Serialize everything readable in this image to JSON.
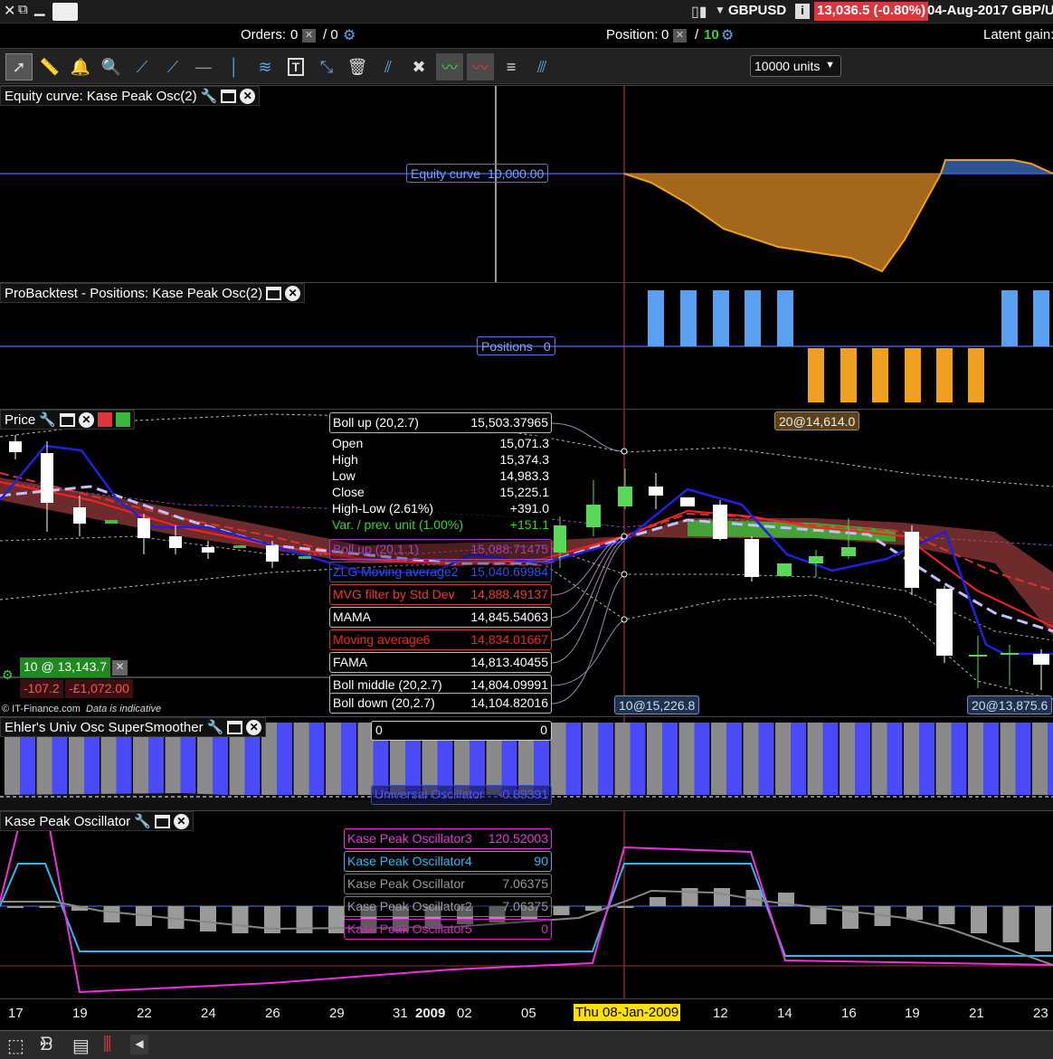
{
  "titlebar": {
    "symbol": "GBPUSD",
    "price_change": "13,036.5 (-0.80%)",
    "date_title": "04-Aug-2017 GBP/U"
  },
  "orders_bar": {
    "orders_label": "Orders:",
    "orders_count": "0",
    "orders_sep": "/ 0",
    "position_label": "Position:",
    "position_count": "0",
    "position_sep": "/",
    "position_units": "10",
    "latent_gain": "Latent gain:"
  },
  "toolbar": {
    "units_select": "10000 units",
    "tools": [
      "pointer-icon",
      "ruler-icon",
      "alert-bell-icon",
      "zoom-icon",
      "line-icon",
      "ray-icon",
      "horizontal-line-icon",
      "vertical-line-icon",
      "fibonacci-icon",
      "text-icon",
      "resize-icon",
      "trash-icon",
      "parallel-lines-icon",
      "tools-icon",
      "indicator-wave-icon",
      "indicator-wave-red-icon",
      "fan-icon",
      "fib-grid-icon"
    ]
  },
  "equity_panel": {
    "title": "Equity curve: Kase Peak Osc(2)",
    "tag_label": "Equity curve",
    "tag_value": "10,000.00"
  },
  "positions_panel": {
    "title": "ProBacktest - Positions: Kase Peak Osc(2)",
    "tag_label": "Positions",
    "tag_value": "0"
  },
  "price_panel": {
    "title": "Price",
    "order_badge": "20@14,614.0",
    "order_badge2": "20@13,875.6",
    "cursor_label": "10@15,226.8",
    "position_box": "10 @ 13,143.7",
    "pnl_points": "-107.2",
    "pnl_money": "-£1,072.00",
    "copyright": "© IT-Finance.com",
    "indicative": "Data is indicative",
    "ohlc": [
      {
        "k": "Open",
        "v": "15,071.3"
      },
      {
        "k": "High",
        "v": "15,374.3"
      },
      {
        "k": "Low",
        "v": "14,983.3"
      },
      {
        "k": "Close",
        "v": "15,225.1"
      },
      {
        "k": "High-Low (2.61%)",
        "v": "+391.0"
      },
      {
        "k": "Var. / prev. unit (1.00%)",
        "v": "+151.1"
      }
    ],
    "legends": [
      {
        "k": "Boll up (20,2.7)",
        "v": "15,503.37965"
      },
      {
        "k": "Boll up (20,1.1)",
        "v": "15,088.71475"
      },
      {
        "k": "ZLG Moving average2",
        "v": "15,040.69984"
      },
      {
        "k": "MVG filter by Std Dev",
        "v": "14,888.49137"
      },
      {
        "k": "MAMA",
        "v": "14,845.54063"
      },
      {
        "k": "Moving average6",
        "v": "14,834.01667"
      },
      {
        "k": "FAMA",
        "v": "14,813.40455"
      },
      {
        "k": "Boll middle (20,2.7)",
        "v": "14,804.09991"
      },
      {
        "k": "Boll down (20,2.7)",
        "v": "14,104.82016"
      }
    ]
  },
  "ehler_panel": {
    "title": "Ehler's Univ Osc SuperSmoother",
    "top_left": "0",
    "top_right": "0",
    "osc_label": "Universal Oscillator",
    "osc_value": "-0.89391"
  },
  "kase_panel": {
    "title": "Kase Peak Oscillator",
    "legends": [
      {
        "k": "Kase Peak Oscillator3",
        "v": "120.52003"
      },
      {
        "k": "Kase Peak Oscillator4",
        "v": "90"
      },
      {
        "k": "Kase Peak Oscillator",
        "v": "7.06375"
      },
      {
        "k": "Kase Peak Oscillator2",
        "v": "7.06375"
      },
      {
        "k": "Kase Peak Oscillator5",
        "v": "0"
      }
    ]
  },
  "xaxis": {
    "ticks": [
      "17",
      "19",
      "22",
      "24",
      "26",
      "29",
      "31",
      "2009",
      "02",
      "05",
      "Thu 08-Jan-2009",
      "12",
      "14",
      "16",
      "19",
      "21",
      "23"
    ]
  }
}
